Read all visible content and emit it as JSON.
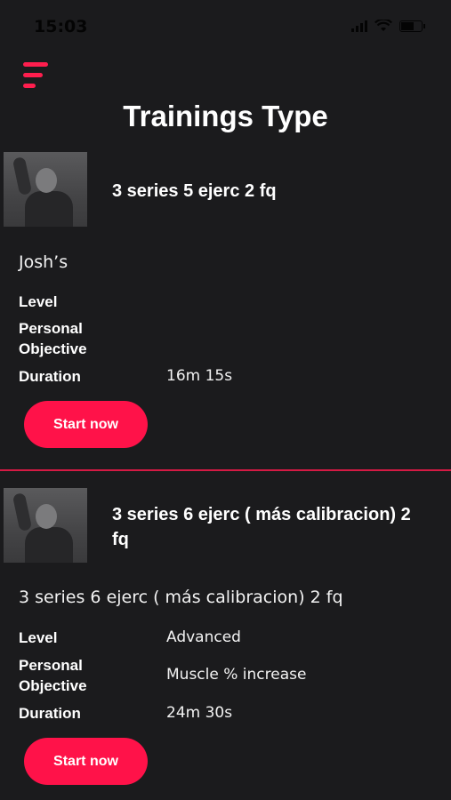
{
  "status_bar": {
    "time": "15:03"
  },
  "page": {
    "title": "Trainings Type"
  },
  "labels": {
    "level": "Level",
    "objective_line1": "Personal",
    "objective_line2": "Objective",
    "duration": "Duration"
  },
  "cards": [
    {
      "title": "3 series 5 ejerc 2 fq",
      "description": "Josh’s",
      "level": "",
      "objective": "",
      "duration": "16m 15s",
      "button_label": "Start now"
    },
    {
      "title": "3 series 6 ejerc ( más calibracion) 2 fq",
      "description": "3 series 6 ejerc ( más calibracion) 2 fq",
      "level": "Advanced",
      "objective": "Muscle % increase",
      "duration": "24m 30s",
      "button_label": "Start now"
    }
  ],
  "colors": {
    "background": "#1b1b1d",
    "accent": "#ff1249",
    "divider": "#d51a44"
  }
}
